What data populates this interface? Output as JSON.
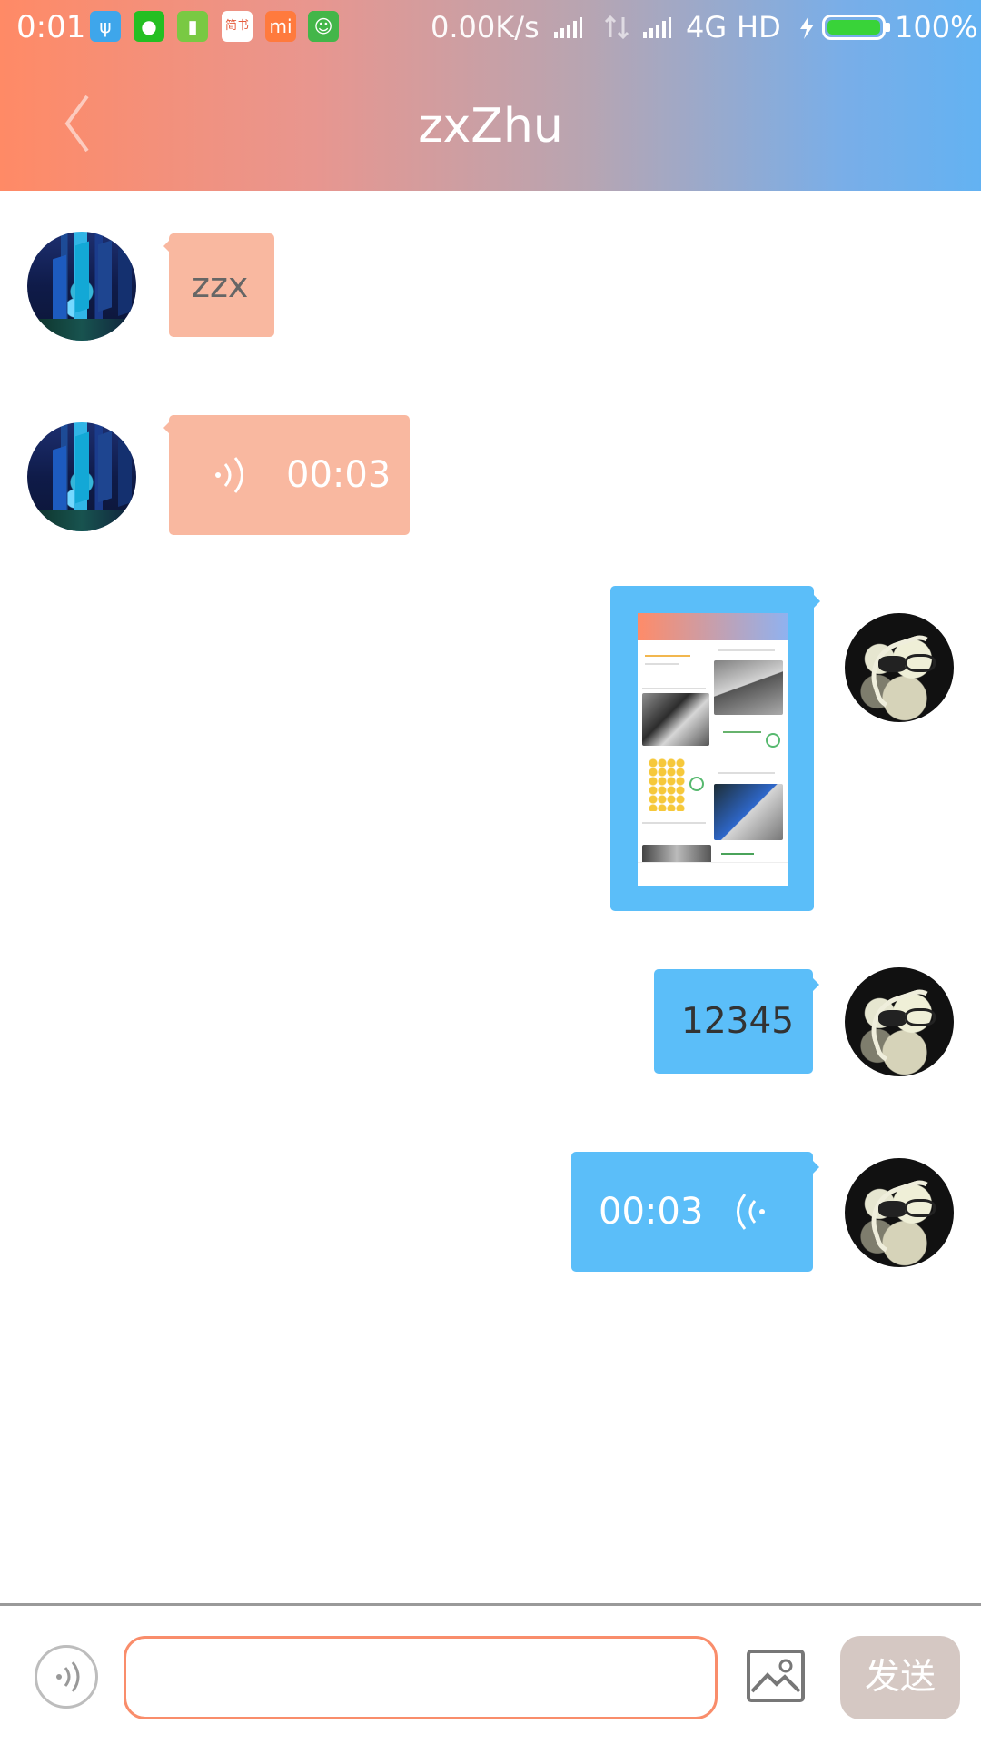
{
  "status_bar": {
    "time": "0:01",
    "network_speed": "0.00K/s",
    "network_type": "4G",
    "hd": "HD",
    "battery_percent_label": "100%",
    "battery_level": 1.0,
    "app_icons": [
      {
        "name": "usb-icon",
        "glyph": "ψ",
        "color": "#3ea6eb"
      },
      {
        "name": "wechat-icon",
        "glyph": "●",
        "color": "#24bf22"
      },
      {
        "name": "battery-app-icon",
        "glyph": "▮",
        "color": "#79c943"
      },
      {
        "name": "jianshu-icon",
        "glyph": "简书",
        "color": "#ffffff"
      },
      {
        "name": "mi-store-icon",
        "glyph": "mi",
        "color": "#ff7a3d"
      },
      {
        "name": "cat-app-icon",
        "glyph": "☺",
        "color": "#43b649"
      }
    ]
  },
  "header": {
    "title": "zxZhu",
    "back_icon": "chevron-left-icon"
  },
  "messages": [
    {
      "side": "incoming",
      "type": "text",
      "text": "zzx"
    },
    {
      "side": "incoming",
      "type": "voice",
      "duration": "00:03"
    },
    {
      "side": "outgoing",
      "type": "image",
      "alt": ""
    },
    {
      "side": "outgoing",
      "type": "text",
      "text": "12345"
    },
    {
      "side": "outgoing",
      "type": "voice",
      "duration": "00:03"
    }
  ],
  "composer": {
    "voice_button_icon": "voice-icon",
    "input_value": "",
    "input_placeholder": "",
    "image_button_icon": "image-icon",
    "send_label": "发送"
  },
  "colors": {
    "incoming_bubble": "#f9b8a0",
    "outgoing_bubble": "#5bbef9",
    "input_border": "#f98d6b",
    "send_button": "#d5c8c3"
  }
}
